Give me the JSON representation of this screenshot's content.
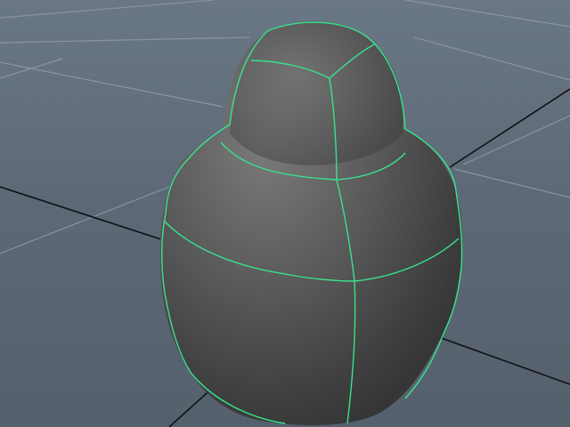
{
  "viewport": {
    "background_color": "#5f6b78",
    "grid_color": "#8a96a3",
    "axis_color": "#111111"
  },
  "object": {
    "shading_color": "#5a5a5a",
    "wireframe_color": "#38e38d",
    "selected": true
  }
}
